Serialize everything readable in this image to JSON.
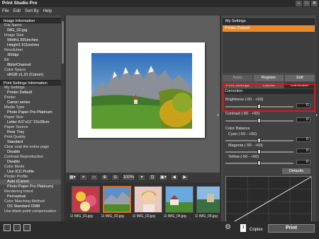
{
  "app": {
    "title": "Print Studio Pro"
  },
  "menu": [
    "File",
    "Edit",
    "Sort By",
    "Help"
  ],
  "left_panel": {
    "image_info_header": "Image Information",
    "image_info": [
      {
        "label": "File Name",
        "value": "IMG_02.jpg"
      },
      {
        "label": "Image Size",
        "value": "Width1.891inches"
      },
      {
        "label": "",
        "value": "Height1.511inches"
      },
      {
        "label": "Resolution",
        "value": "350dpi"
      },
      {
        "label": "Bit",
        "value": "8bits/Channel"
      },
      {
        "label": "Color Space",
        "value": "sRGB v1.31 (Canon)"
      }
    ],
    "print_info_header": "Print Settings Information",
    "print_info": [
      {
        "label": "My Settings",
        "value": "Printer Default"
      },
      {
        "label": "Printer",
        "value": "Canon                    series"
      },
      {
        "label": "Media Type",
        "value": "Photo Paper Pro Platinum"
      },
      {
        "label": "Paper Size",
        "value": "Letter 8.5\"x11\" 22x28cm"
      },
      {
        "label": "Paper Source",
        "value": "Rear Tray"
      },
      {
        "label": "Print Quality",
        "value": "Standard"
      },
      {
        "label": "Clear coat the entire page",
        "value": "Disable"
      },
      {
        "label": "Contrast Reproduction",
        "value": "Disable"
      },
      {
        "label": "Color Mode",
        "value": "Use ICC Profile"
      },
      {
        "label": "Printer Profile",
        "value": "Auto (Canon"
      },
      {
        "label": "",
        "value": "Photo Paper Pro Platinum)"
      },
      {
        "label": "Rendering Intent",
        "value": "Perceptual"
      },
      {
        "label": "Color Matching Method",
        "value": "OS Standard CMM"
      },
      {
        "label": "Use black point compensation",
        "value": ""
      }
    ]
  },
  "toolbar": {
    "zoom": "100%"
  },
  "thumbnails": [
    {
      "name": "IMG_01.jpg",
      "selected": false
    },
    {
      "name": "IMG_02.jpg",
      "selected": true
    },
    {
      "name": "IMG_03.jpg",
      "selected": false
    },
    {
      "name": "IMG_04.jpg",
      "selected": false
    },
    {
      "name": "IMG_05.jpg",
      "selected": false
    }
  ],
  "right_panel": {
    "my_settings_header": "My Settings",
    "selected_setting": "Printer Default",
    "buttons": {
      "apply": "Apply",
      "register": "Register",
      "edit": "Edit"
    },
    "tabs": [
      "Print Settings",
      "Layout",
      "Correction"
    ],
    "active_tab": "Correction",
    "correction_header": "Correction",
    "brightness": {
      "label": "Brightness (-50 - +50)",
      "value": "0",
      "level": 0.5
    },
    "contrast": {
      "label": "Contrast (-50 - +50)",
      "value": "0",
      "level": 0.5
    },
    "color_balance_label": "Color Balance",
    "cyan": {
      "label": "Cyan (-50 - +50)",
      "value": "0",
      "level": 0.5
    },
    "magenta": {
      "label": "Magenta (-50 - +50)",
      "value": "0",
      "level": 0.5
    },
    "yellow": {
      "label": "Yellow (-50 - +50)",
      "value": "0",
      "level": 0.5
    },
    "defaults_label": "Defaults"
  },
  "footer": {
    "copies": "1",
    "copies_label": "Copies",
    "print_label": "Print"
  },
  "colors": {
    "accent": "#e8892e",
    "highlight_box": "#e0141e"
  }
}
